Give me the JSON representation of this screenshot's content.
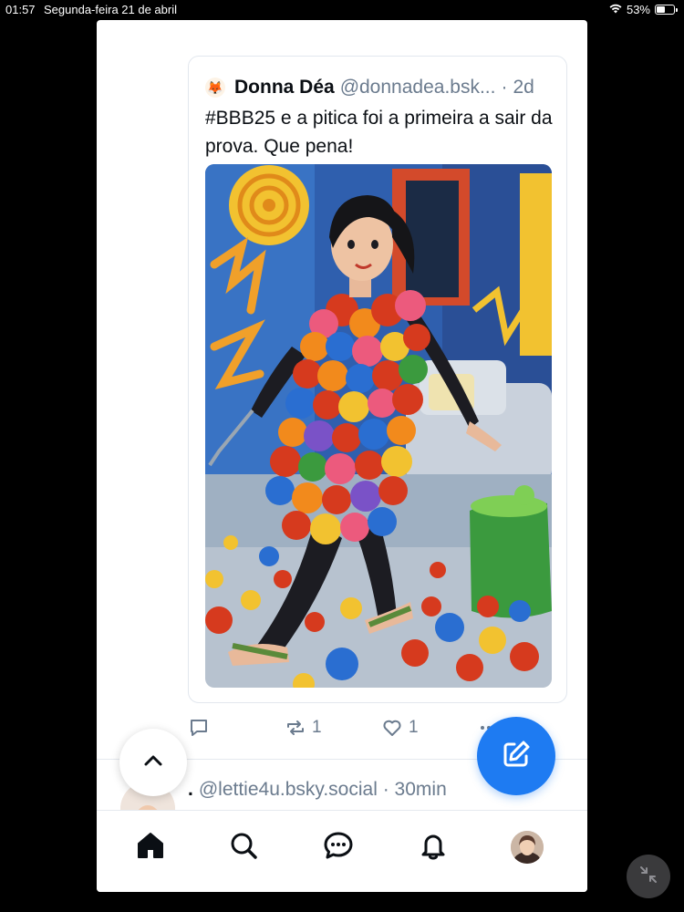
{
  "status_bar": {
    "time": "01:57",
    "date": "Segunda-feira 21 de abril",
    "battery_text": "53%",
    "battery_level": 0.53
  },
  "quote": {
    "avatar_emoji": "🦊",
    "author_name": "Donna Déa",
    "handle": "@donnadea.bsk...",
    "separator": "·",
    "time": "2d",
    "text": "#BBB25 e a pitica foi a primeira a sair da prova. Que pena!",
    "image_icon": "illustration-woman-ballpit-dress"
  },
  "actions": {
    "reply_icon": "comment-icon",
    "reply_count": "",
    "repost_icon": "repost-icon",
    "repost_count": "1",
    "like_icon": "heart-icon",
    "like_count": "1",
    "more_icon": "more-icon"
  },
  "next_post": {
    "lead": ".",
    "handle": "@lettie4u.bsky.social",
    "separator": "·",
    "time": "30min"
  },
  "tabbar": {
    "items": [
      {
        "icon": "home-icon"
      },
      {
        "icon": "search-icon"
      },
      {
        "icon": "chat-icon"
      },
      {
        "icon": "bell-icon"
      },
      {
        "icon": "profile-avatar"
      }
    ]
  },
  "floating": {
    "scroll_top_icon": "chevron-up-icon",
    "compose_icon": "compose-icon",
    "system_icon": "minimize-icon"
  },
  "colors": {
    "accent": "#1e7bf2",
    "text": "#0b0f14",
    "muted": "#6b7b8e",
    "border": "#e2e7ee"
  }
}
